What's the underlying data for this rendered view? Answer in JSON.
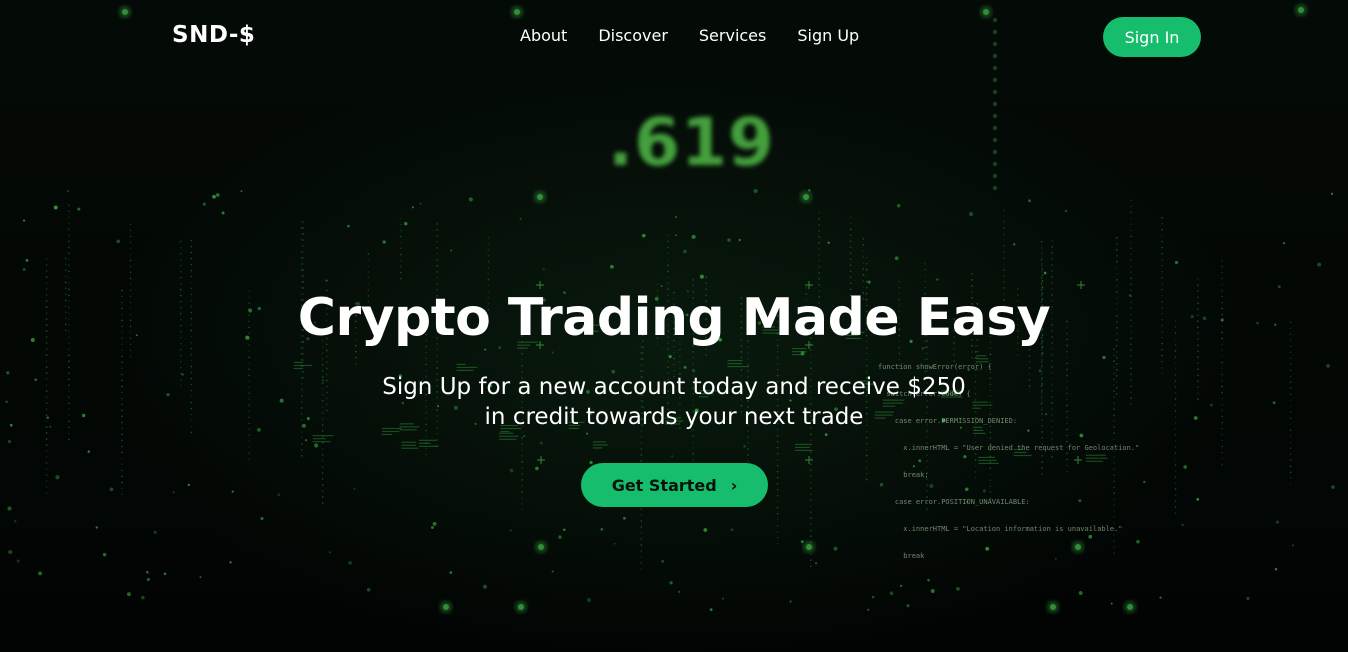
{
  "navbar": {
    "logo": "SND-$",
    "links": [
      "About",
      "Discover",
      "Services",
      "Sign Up"
    ],
    "signin_label": "Sign In"
  },
  "background": {
    "ticker_text": ".619",
    "code_lines": [
      "function showError(error) {",
      "  switch(error.code) {",
      "    case error.PERMISSION_DENIED:",
      "      x.innerHTML = \"User denied the request for Geolocation.\"",
      "      break;",
      "    case error.POSITION_UNAVAILABLE:",
      "      x.innerHTML = \"Location information is unavailable.\"",
      "      break"
    ]
  },
  "hero": {
    "title": "Crypto Trading Made Easy",
    "subtitle_line1": "Sign Up for a new account today and receive $250",
    "subtitle_line2": "in credit towards your next trade",
    "cta_label": "Get Started"
  },
  "colors": {
    "accent": "#16bd6c",
    "matrix_green": "#3fbf4a",
    "background": "#020604"
  }
}
